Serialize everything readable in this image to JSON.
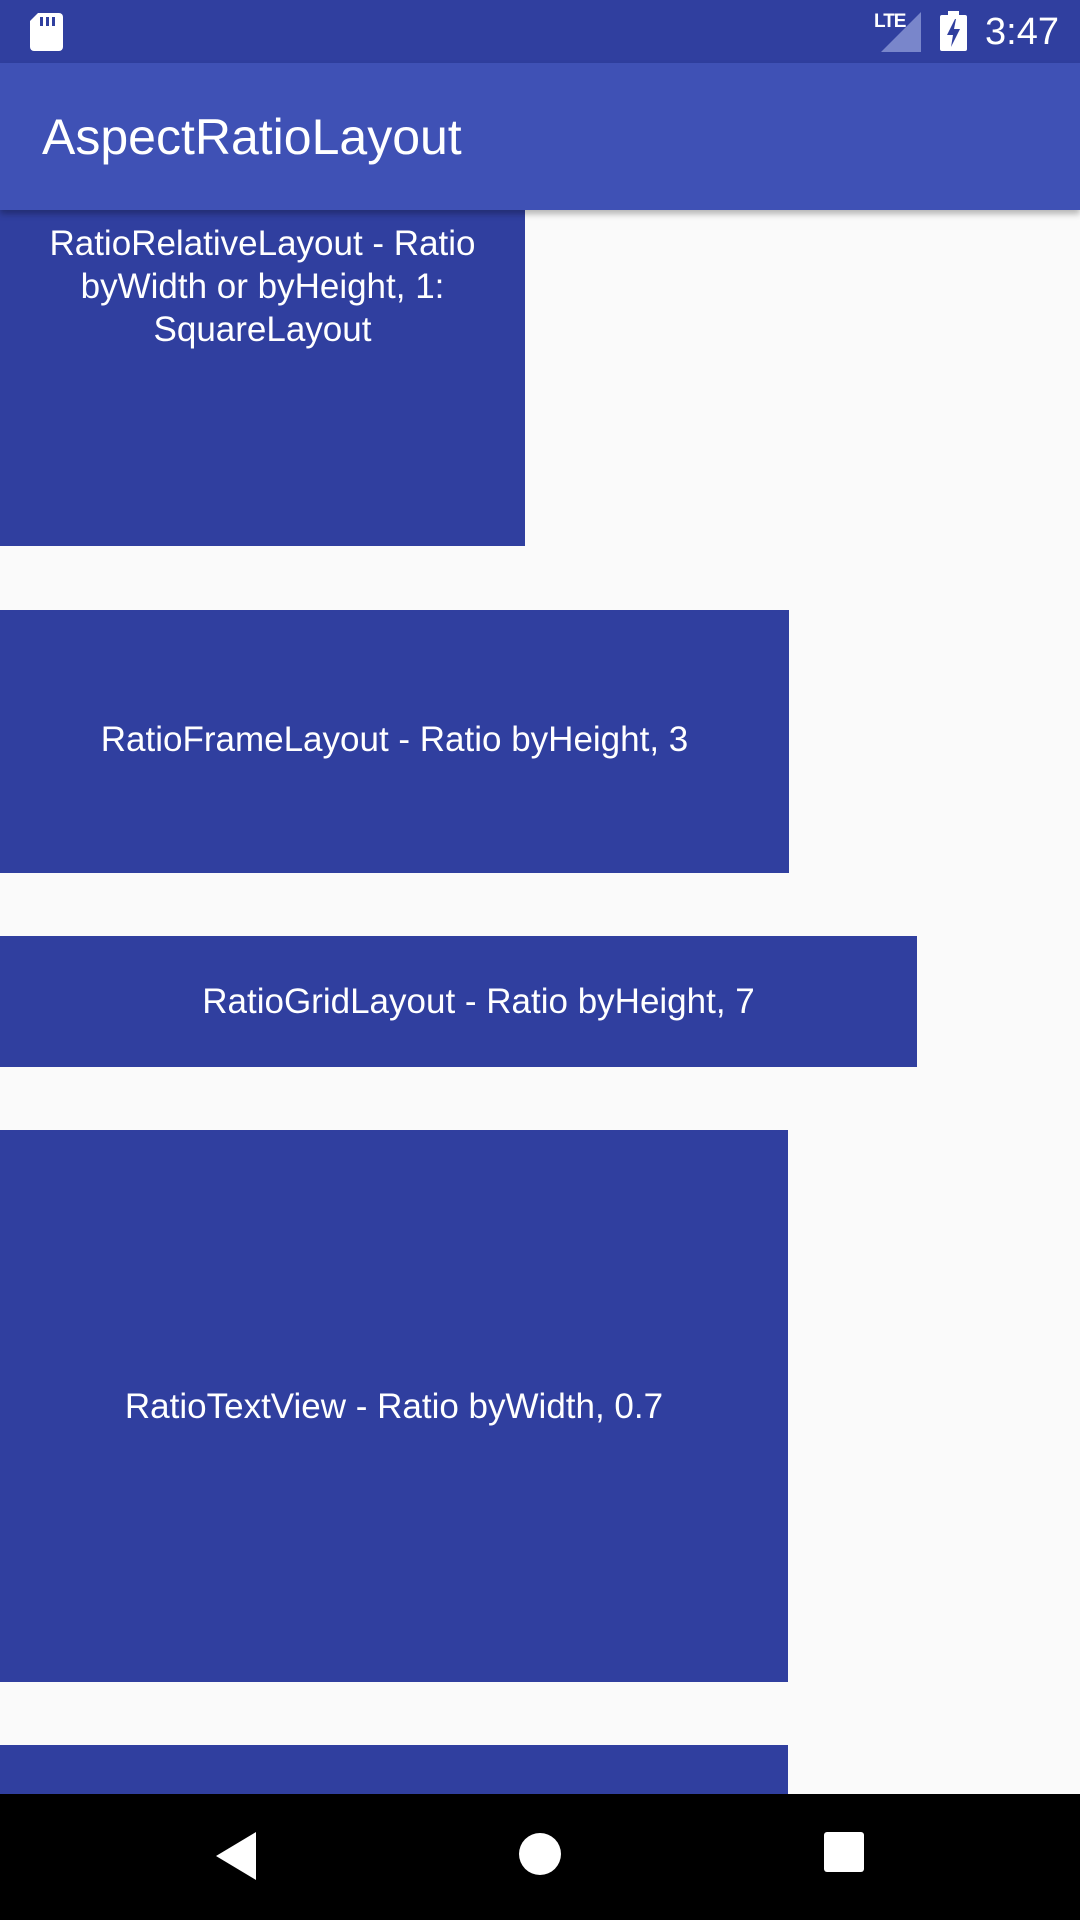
{
  "status_bar": {
    "network_label": "LTE",
    "time": "3:47",
    "icons": [
      "sd-card-icon",
      "signal-icon",
      "battery-charging-icon"
    ]
  },
  "app_bar": {
    "title": "AspectRatioLayout"
  },
  "layouts": [
    {
      "label": "RatioRelativeLayout - Ratio byWidth or byHeight, 1: SquareLayout"
    },
    {
      "label": "RatioFrameLayout - Ratio byHeight, 3"
    },
    {
      "label": "RatioGridLayout - Ratio byHeight, 7"
    },
    {
      "label": "RatioTextView - Ratio byWidth, 0.7"
    },
    {
      "label": ""
    }
  ],
  "navigation_bar": {
    "icons": [
      "back-icon",
      "home-icon",
      "recents-icon"
    ]
  },
  "colors": {
    "primary": "#3f51b5",
    "primary_dark": "#303f9f",
    "background": "#fafafa",
    "nav_bar": "#000000",
    "text_on_primary": "#ffffff"
  }
}
